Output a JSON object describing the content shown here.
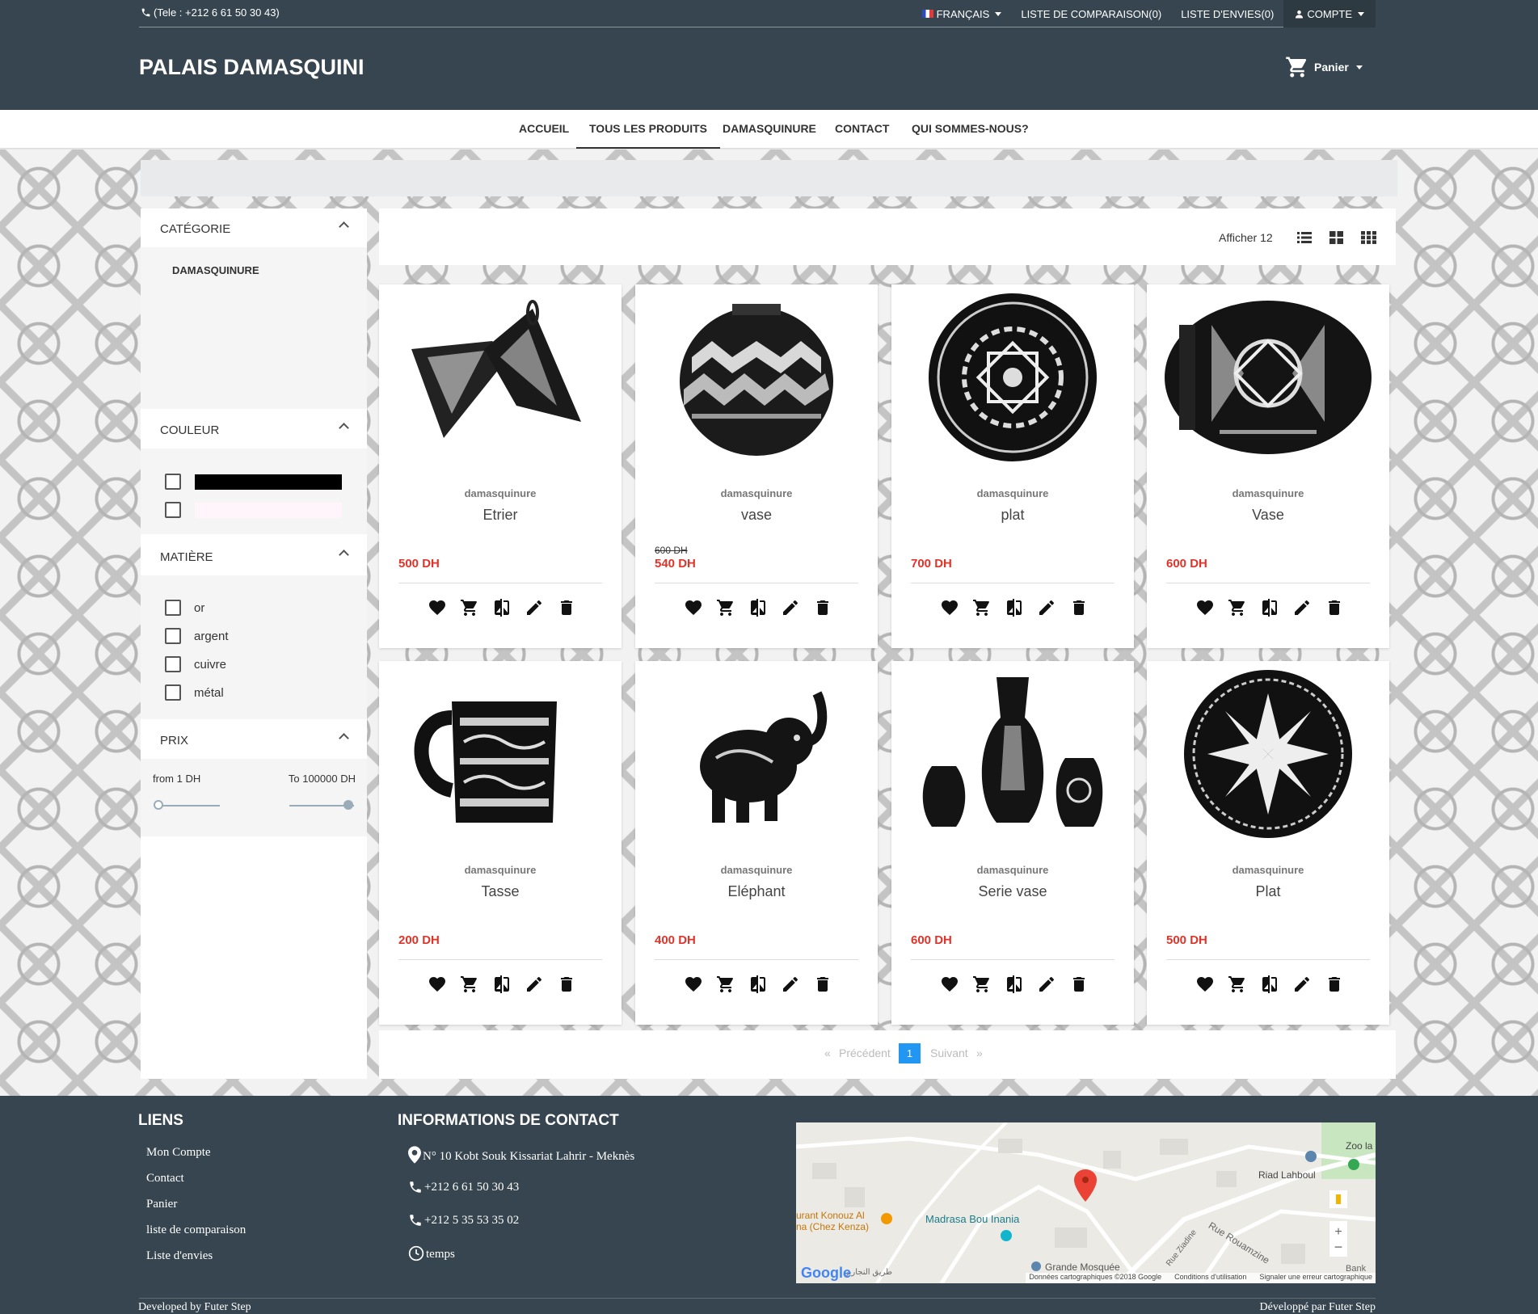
{
  "topbar": {
    "phone": "(Tele : +212 6 61 50 30 43)",
    "language": "FRANÇAIS",
    "comparison": "LISTE DE COMPARAISON(0)",
    "wishlist": "LISTE D'ENVIES(0)",
    "account": "COMPTE"
  },
  "header": {
    "brand": "PALAIS DAMASQUINI",
    "cart": "Panier"
  },
  "nav": [
    "ACCUEIL",
    "TOUS LES PRODUITS",
    "DAMASQUINURE",
    "CONTACT",
    "QUI SOMMES-NOUS?"
  ],
  "filters": {
    "category_title": "CATÉGORIE",
    "category_item": "DAMASQUINURE",
    "color_title": "COULEUR",
    "colors": [
      "#000000",
      "#fff5fb"
    ],
    "material_title": "MATIÈRE",
    "materials": [
      "or",
      "argent",
      "cuivre",
      "métal"
    ],
    "price_title": "PRIX",
    "price_from": "from 1 DH",
    "price_to": "To 100000 DH"
  },
  "toolbar": {
    "show": "Afficher 12"
  },
  "products": [
    {
      "category": "damasquinure",
      "name": "Etrier",
      "price": "500 DH",
      "old_price": ""
    },
    {
      "category": "damasquinure",
      "name": "vase",
      "price": "540 DH",
      "old_price": "600 DH"
    },
    {
      "category": "damasquinure",
      "name": "plat",
      "price": "700 DH",
      "old_price": ""
    },
    {
      "category": "damasquinure",
      "name": "Vase",
      "price": "600 DH",
      "old_price": ""
    },
    {
      "category": "damasquinure",
      "name": "Tasse",
      "price": "200 DH",
      "old_price": ""
    },
    {
      "category": "damasquinure",
      "name": "Eléphant",
      "price": "400 DH",
      "old_price": ""
    },
    {
      "category": "damasquinure",
      "name": "Serie vase",
      "price": "600 DH",
      "old_price": ""
    },
    {
      "category": "damasquinure",
      "name": "Plat",
      "price": "500 DH",
      "old_price": ""
    }
  ],
  "pagination": {
    "prev": "Précédent",
    "current": "1",
    "next": "Suivant",
    "prev_arrow": "«",
    "next_arrow": "»"
  },
  "footer": {
    "links_title": "LIENS",
    "links": [
      "Mon Compte",
      "Contact",
      "Panier",
      "liste de comparaison",
      "Liste d'envies"
    ],
    "contact_title": "INFORMATIONS DE CONTACT",
    "address": "N° 10 Kobt Souk Kissariat Lahrir - Meknès",
    "phone1": "+212 6 61 50 30 43",
    "phone2": "+212 5 35 53 35 02",
    "hours": "temps",
    "map_labels": {
      "zoo": "Zoo la",
      "riad": "Riad Lahboul",
      "restaurant1": "urant Konouz Al",
      "restaurant2": "na (Chez Kenza)",
      "madrasa": "Madrasa Bou Inania",
      "mosque": "Grande Mosquée",
      "street1": "Rue Ziadine",
      "street2": "Rue Rouamzine",
      "bank": "Bank",
      "arabic_street": "طريق النجارين",
      "google": "Google",
      "copyright": "Données cartographiques ©2018 Google",
      "terms": "Conditions d'utilisation",
      "report": "Signaler une erreur cartographique"
    },
    "dev_left": "Developed by Futer Step",
    "dev_right": "Développé par Futer Step"
  }
}
